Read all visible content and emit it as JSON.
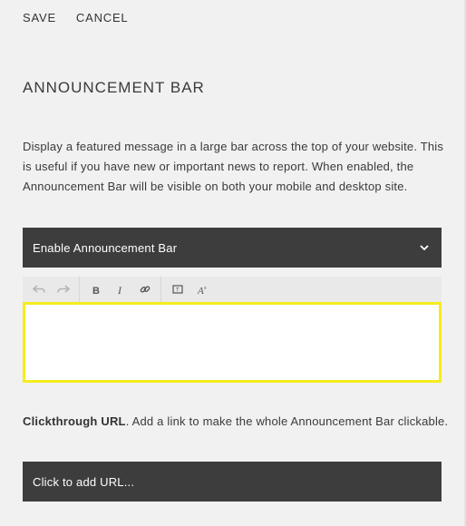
{
  "toolbar_top": {
    "save_label": "SAVE",
    "cancel_label": "CANCEL"
  },
  "section": {
    "title": "ANNOUNCEMENT BAR",
    "description": "Display a featured message in a large bar across the top of your website. This is useful if you have new or important news to report. When enabled, the Announcement Bar will be visible on both your mobile and desktop site."
  },
  "enable_select": {
    "selected_label": "Enable Announcement Bar",
    "icon": "chevron-down-icon"
  },
  "editor_toolbar": {
    "groups": [
      [
        "undo-icon",
        "redo-icon"
      ],
      [
        "bold-icon",
        "italic-icon",
        "link-icon"
      ],
      [
        "insert-block-icon",
        "clear-format-icon"
      ]
    ]
  },
  "editor": {
    "value": "",
    "highlight_color": "#f5ec1e"
  },
  "clickthrough": {
    "label": "Clickthrough URL",
    "description": ". Add a link to make the whole Announcement Bar clickable.",
    "placeholder": "Click to add URL..."
  },
  "colors": {
    "background": "#f1f1f1",
    "field_dark": "#3d3d3d",
    "text": "#3a3a3a"
  }
}
